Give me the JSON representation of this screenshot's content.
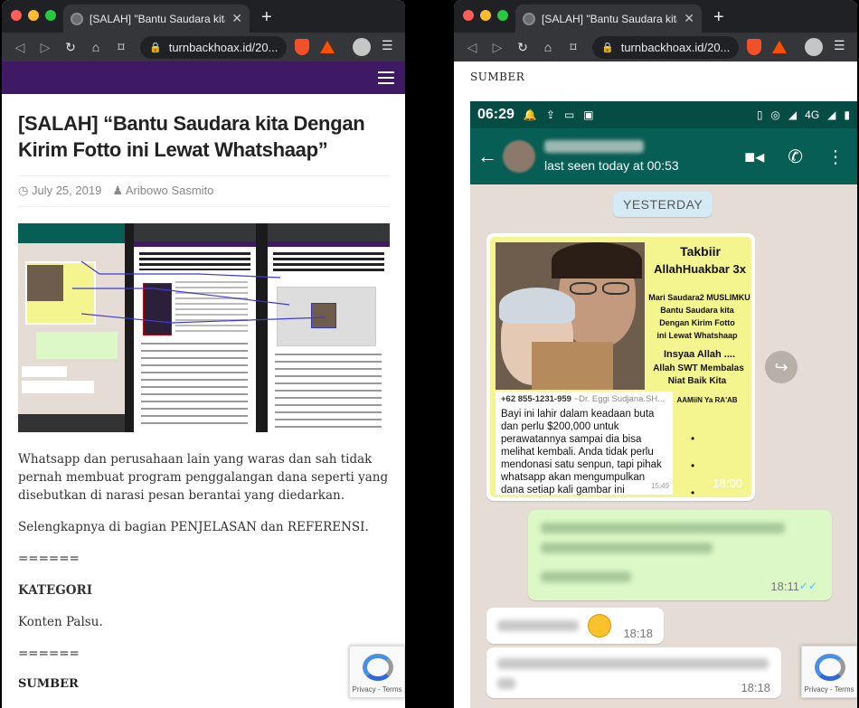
{
  "browser": {
    "tab_title": "[SALAH] \"Bantu Saudara kita De",
    "url": "turnbackhoax.id/20...",
    "new_tab": "+",
    "close": "✕"
  },
  "article": {
    "title": "[SALAH] “Bantu Saudara kita Dengan Kirim Fotto ini Lewat Whatshaap”",
    "date": "July 25, 2019",
    "author": "Aribowo Sasmito",
    "para1": "Whatsapp dan perusahaan lain yang waras dan sah tidak pernah membuat program penggalangan dana seperti yang disebutkan di narasi pesan berantai yang diedarkan.",
    "para2": "Selengkapnya di bagian PENJELASAN dan REFERENSI.",
    "sep1": "======",
    "kategori": "KATEGORI",
    "konten": "Konten Palsu.",
    "sep2": "======",
    "sumber": "SUMBER"
  },
  "recaptcha": {
    "label": "Privacy - Terms"
  },
  "right": {
    "sumber": "SUMBER",
    "status_time": "06:29",
    "network": "4G",
    "last_seen": "last seen today at 00:53",
    "date_pill": "YESTERDAY",
    "poster": {
      "t1": "Takbiir",
      "t2": "AllahHuakbar 3x",
      "t3": "Mari Saudara2 MUSLIMKU",
      "t4": "Bantu Saudara kita",
      "t5": "Dengan Kirim Fotto",
      "t6": "ini Lewat Whatshaap",
      "t7": "Insyaa Allah ....",
      "t8": "Allah SWT Membalas",
      "t9": "Niat Baik Kita",
      "t10": "AAMiiN Ya RA'AB",
      "phone": "+62 855-1231-959",
      "sender": "~Dr. Eggi Sudjana.SH...",
      "message": "Bayi ini lahir dalam keadaan buta dan perlu $200,000 untuk perawatannya sampai dia bisa melihat kembali. Anda tidak perlu mendonasi satu senpun, tapi pihak whatsapp akan mengumpulkan dana setiap kali gambar ini dibagikan. Silahkan bagikan",
      "inner_time": "15:49",
      "time": "18:00"
    },
    "msg_out_time": "18:11",
    "msg_in1_time": "18:18",
    "msg_in2_time": "18:18"
  },
  "colors": {
    "site_header": "#3d1a63",
    "wa_dark": "#075e54",
    "wa_out": "#dcf8c6",
    "poster_bg": "#f4f58f"
  }
}
